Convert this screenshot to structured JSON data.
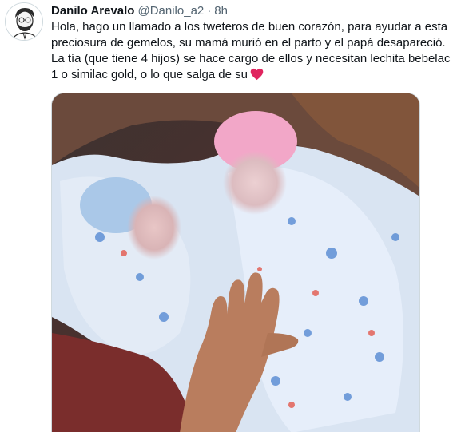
{
  "tweet": {
    "author": {
      "display_name": "Danilo Arevalo",
      "handle": "@Danilo_a2",
      "avatar_icon": "cartoon-face-avatar"
    },
    "separator": "·",
    "timestamp": "8h",
    "text_lines": [
      "Hola, hago un llamado a los tweteros de buen corazón, para ayudar a esta",
      "preciosura de gemelos, su mamá murió en el parto y el papá desapareció.",
      "La tía (que tiene 4 hijos) se hace cargo de ellos y necesitan lechita bebelac",
      "1 o similac gold, o lo que salga de su"
    ],
    "emoji": "red-heart",
    "media": {
      "kind": "photo",
      "description_icon": "twin-babies-photo"
    },
    "colors": {
      "text": "#0f1419",
      "secondary": "#536471",
      "border": "#cfd9de",
      "heart": "#e0245e"
    }
  }
}
